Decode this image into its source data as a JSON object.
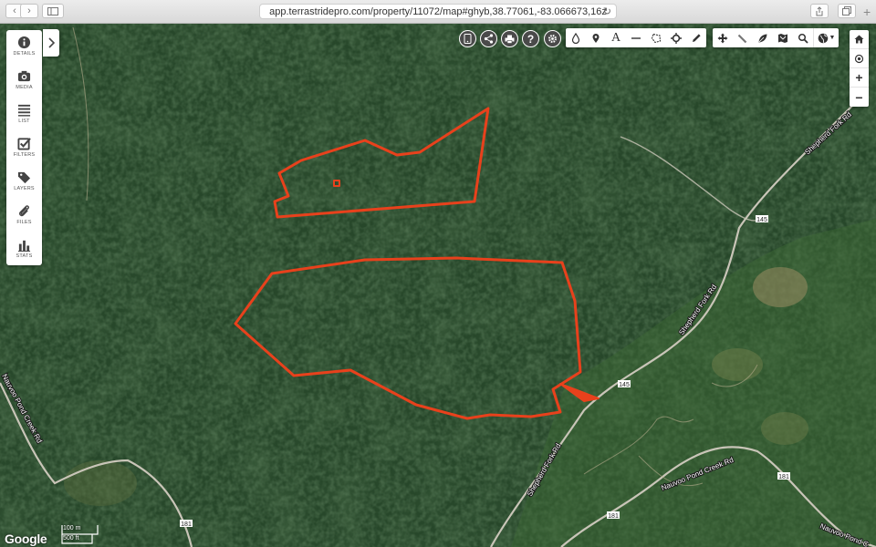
{
  "browser": {
    "url": "app.terrastridepro.com/property/11072/map#ghyb,38.77061,-83.066673,16z",
    "back_icon": "chevron-left-icon",
    "forward_icon": "chevron-right-icon",
    "reload_icon": "reload-icon"
  },
  "left_panel": {
    "items": [
      {
        "label": "DETAILS",
        "icon": "info-icon"
      },
      {
        "label": "MEDIA",
        "icon": "camera-icon"
      },
      {
        "label": "LIST",
        "icon": "list-icon"
      },
      {
        "label": "FILTERS",
        "icon": "checkbox-icon"
      },
      {
        "label": "LAYERS",
        "icon": "tag-icon"
      },
      {
        "label": "FILES",
        "icon": "paperclip-icon"
      },
      {
        "label": "STATS",
        "icon": "bar-chart-icon"
      }
    ],
    "collapse_icon": "chevron-right-icon"
  },
  "map_actions": [
    "mobile-icon",
    "share-icon",
    "print-icon",
    "help-icon",
    "settings-icon"
  ],
  "draw_tools": [
    "drop-icon",
    "pin-icon",
    "text-icon",
    "line-icon",
    "polygon-icon",
    "target-icon",
    "pencil-icon"
  ],
  "view_tools": [
    "move-icon",
    "measure-icon",
    "leaf-icon",
    "map-icon",
    "search-icon",
    "globe-icon"
  ],
  "text_tool_label": "A",
  "right_controls": [
    "home-icon",
    "locate-icon",
    "zoom-in-icon",
    "zoom-out-icon"
  ],
  "zoom_in_label": "+",
  "zoom_out_label": "−",
  "road_labels": {
    "shepherd_fork_rd_1": "Shepherd Fork Rd",
    "shepherd_fork_rd_2": "Shepherd Fork Rd",
    "shepherd_fork_rd_3": "Shepherd Fork Rd",
    "nauvoo_pond_creek_rd_1": "Nauvoo Pond Creek Rd",
    "nauvoo_pond_creek_rd_2": "Nauvoo Pond Creek Rd",
    "nauvoo_pond_creek_rd_3": "Nauvoo Pond C"
  },
  "route_shields": {
    "s145_a": "145",
    "s145_b": "145",
    "s181_a": "181",
    "s181_b": "181",
    "s181_c": "181"
  },
  "attribution": "Google",
  "scale": {
    "metric": "100 m",
    "imperial": "500 ft"
  },
  "colors": {
    "boundary": "#e8411c",
    "forest_dark": "#1a3219",
    "forest": "#26472a",
    "road": "#c9c5b8",
    "panel_bg": "#ffffff",
    "action_bg": "#4a4a4a"
  }
}
